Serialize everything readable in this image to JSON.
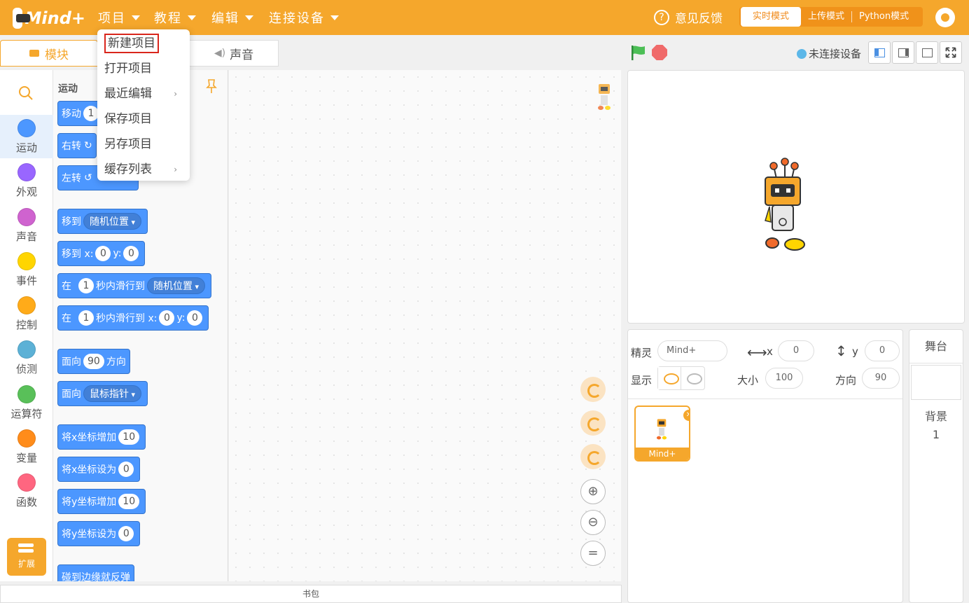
{
  "app": {
    "logo_text": "Mind+"
  },
  "topmenu": [
    {
      "label": "项目"
    },
    {
      "label": "教程"
    },
    {
      "label": "编辑"
    },
    {
      "label": "连接设备"
    }
  ],
  "header": {
    "feedback": "意见反馈",
    "modes": [
      "实时模式",
      "上传模式",
      "Python模式"
    ]
  },
  "tabs": {
    "blocks": "模块",
    "sound": "声音"
  },
  "connection": {
    "status": "未连接设备"
  },
  "project_menu": {
    "items": [
      {
        "label": "新建项目",
        "submenu": false
      },
      {
        "label": "打开项目",
        "submenu": false
      },
      {
        "label": "最近编辑",
        "submenu": true
      },
      {
        "label": "保存项目",
        "submenu": false
      },
      {
        "label": "另存项目",
        "submenu": false
      },
      {
        "label": "缓存列表",
        "submenu": true
      }
    ]
  },
  "categories": [
    {
      "label": "运动",
      "color": "#4c97ff"
    },
    {
      "label": "外观",
      "color": "#9966ff"
    },
    {
      "label": "声音",
      "color": "#cf63cf"
    },
    {
      "label": "事件",
      "color": "#ffd500"
    },
    {
      "label": "控制",
      "color": "#ffab19"
    },
    {
      "label": "侦测",
      "color": "#5cb1d6"
    },
    {
      "label": "运算符",
      "color": "#59c059"
    },
    {
      "label": "变量",
      "color": "#ff8c1a"
    },
    {
      "label": "函数",
      "color": "#ff6680"
    }
  ],
  "extension": {
    "label": "扩展"
  },
  "palette": {
    "title": "运动",
    "blocks": {
      "move": "移动",
      "move_val": "1",
      "turn_right": "右转",
      "turn_left": "左转",
      "goto": "移到",
      "goto_target": "随机位置",
      "goto_xy": "移到 x:",
      "goto_x": "0",
      "y_label": "y:",
      "goto_y": "0",
      "glide_in": "在",
      "glide_secs": "1",
      "glide_to": "秒内滑行到",
      "glide_target": "随机位置",
      "glide_to_xy": "秒内滑行到 x:",
      "glide_x": "0",
      "glide_y": "0",
      "point_dir": "面向",
      "point_val": "90",
      "point_unit": "方向",
      "point_towards": "面向",
      "point_target": "鼠标指针",
      "change_x": "将x坐标增加",
      "change_x_val": "10",
      "set_x": "将x坐标设为",
      "set_x_val": "0",
      "change_y": "将y坐标增加",
      "change_y_val": "10",
      "set_y": "将y坐标设为",
      "set_y_val": "0",
      "bounce": "碰到边缘就反弹"
    }
  },
  "backpack": {
    "label": "书包"
  },
  "sprite_info": {
    "sprite_label": "精灵",
    "sprite_name": "Mind+",
    "x_label": "x",
    "x_val": "0",
    "y_label": "y",
    "y_val": "0",
    "show_label": "显示",
    "size_label": "大小",
    "size_val": "100",
    "dir_label": "方向",
    "dir_val": "90",
    "sprites": [
      {
        "name": "Mind+"
      }
    ]
  },
  "stage_panel": {
    "title": "舞台",
    "backdrop_label": "背景",
    "backdrop_count": "1"
  },
  "colors": {
    "brand": "#f5a72c",
    "motion": "#4c97ff"
  }
}
